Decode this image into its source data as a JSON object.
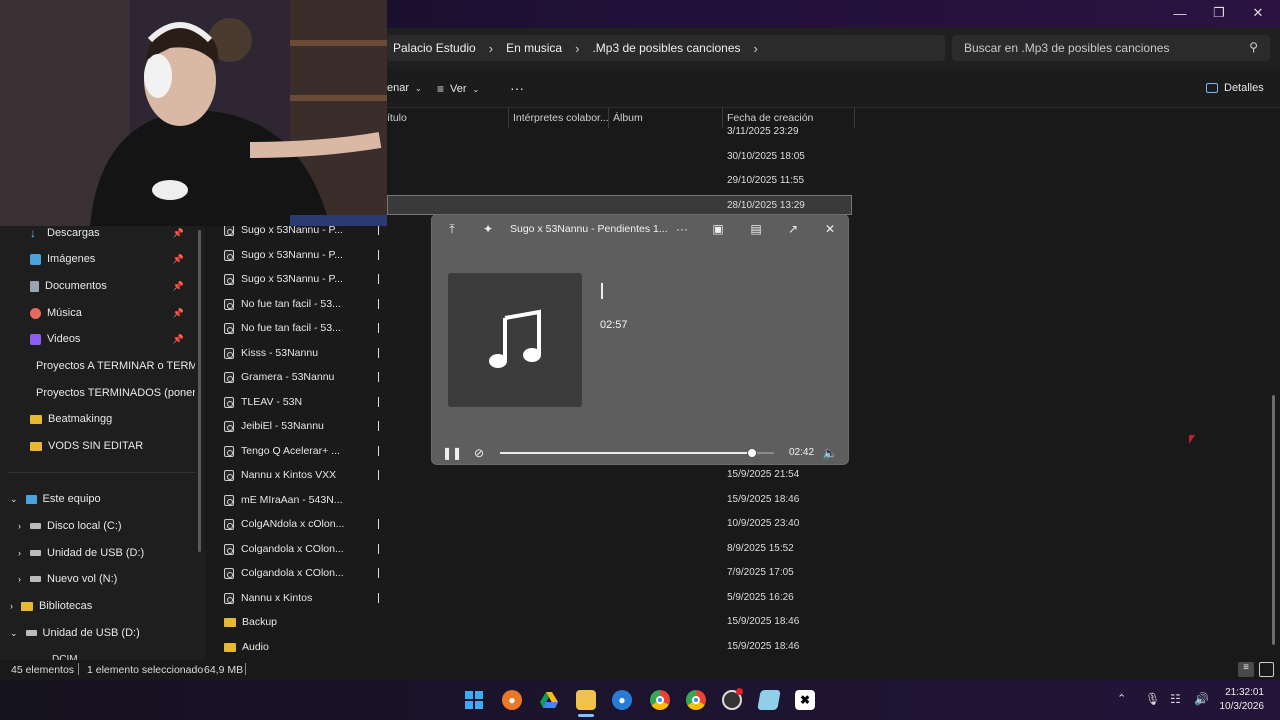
{
  "breadcrumbs": [
    "Palacio Estudio",
    "En musica",
    ".Mp3 de posibles canciones"
  ],
  "search_placeholder": "Buscar en .Mp3 de posibles canciones",
  "toolbar": {
    "sort_partial": "enar",
    "view_label": "Ver",
    "more_label": "···",
    "details_label": "Detalles"
  },
  "columns": {
    "title_partial": "ítulo",
    "artists": "Intérpretes colabor...",
    "album": "Álbum",
    "created": "Fecha de creación"
  },
  "top_dates": [
    "3/11/2025 23:29",
    "30/10/2025 18:05",
    "29/10/2025 11:55",
    "28/10/2025 13:29"
  ],
  "nav": {
    "quick": [
      {
        "label": "Descargas",
        "icon": "download-icon"
      },
      {
        "label": "Imágenes",
        "icon": "pictures-icon"
      },
      {
        "label": "Documentos",
        "icon": "documents-icon"
      },
      {
        "label": "Música",
        "icon": "music-icon"
      },
      {
        "label": "Videos",
        "icon": "videos-icon"
      }
    ],
    "folders": [
      "Proyectos A TERMINAR o TERMIN",
      "Proyectos TERMINADOS (poner p",
      "Beatmakingg",
      "VODS SIN EDITAR"
    ],
    "this_pc": "Este equipo",
    "drives": [
      "Disco local (C:)",
      "Unidad de USB (D:)",
      "Nuevo vol (N:)"
    ],
    "libraries": "Bibliotecas",
    "usb": "Unidad de USB (D:)",
    "partial": "DCIM"
  },
  "files": [
    {
      "name": "Sugo x 53Nannu - P...",
      "date": ""
    },
    {
      "name": "Sugo x 53Nannu - P...",
      "date": ""
    },
    {
      "name": "Sugo x 53Nannu - P...",
      "date": ""
    },
    {
      "name": "No fue tan facil - 53...",
      "date": ""
    },
    {
      "name": "No fue tan facil - 53...",
      "date": ""
    },
    {
      "name": "Kisss - 53Nannu",
      "date": ""
    },
    {
      "name": "Gramera - 53Nannu",
      "date": ""
    },
    {
      "name": "TLEAV - 53N",
      "date": ""
    },
    {
      "name": "JeibiEl - 53Nannu",
      "date": ""
    },
    {
      "name": "Tengo Q Acelerar+ ...",
      "date": ""
    },
    {
      "name": "Nannu x Kintos VXX",
      "date": "15/9/2025 21:54"
    },
    {
      "name": "mE MIraAan - 543N...",
      "date": "15/9/2025 18:46"
    },
    {
      "name": "ColgANdola x cOlon...",
      "date": "10/9/2025 23:40"
    },
    {
      "name": "Colgandola x COlon...",
      "date": "8/9/2025 15:52"
    },
    {
      "name": "Colgandola x COlon...",
      "date": "7/9/2025 17:05"
    },
    {
      "name": "Nannu x Kintos",
      "date": "5/9/2025 16:26"
    }
  ],
  "folders_list": [
    {
      "name": "Backup",
      "date": "15/9/2025 18:46"
    },
    {
      "name": "Audio",
      "date": "15/9/2025 18:46"
    }
  ],
  "player": {
    "title": "Sugo x 53Nannu - Pendientes 1...",
    "duration": "02:57",
    "position": "02:42",
    "progress": 0.92
  },
  "status": {
    "count": "45 elementos",
    "selected": "1 elemento seleccionado",
    "size": "64,9 MB"
  },
  "clock": {
    "time": "21:32:01",
    "date": "10/3/2026"
  }
}
